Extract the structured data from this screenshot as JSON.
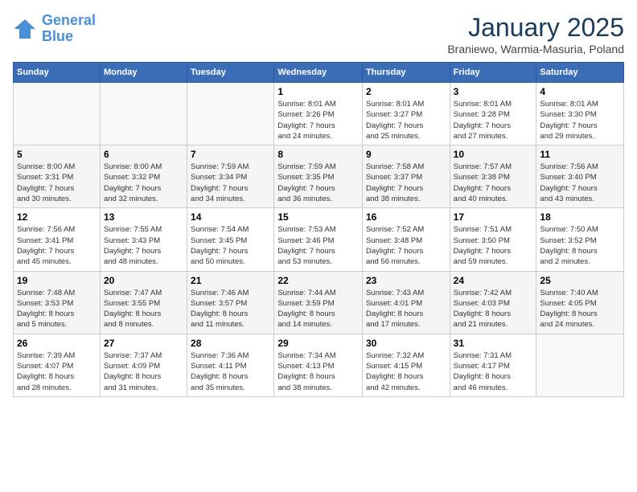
{
  "header": {
    "logo_line1": "General",
    "logo_line2": "Blue",
    "title": "January 2025",
    "subtitle": "Braniewo, Warmia-Masuria, Poland"
  },
  "days_of_week": [
    "Sunday",
    "Monday",
    "Tuesday",
    "Wednesday",
    "Thursday",
    "Friday",
    "Saturday"
  ],
  "weeks": [
    [
      {
        "day": "",
        "info": ""
      },
      {
        "day": "",
        "info": ""
      },
      {
        "day": "",
        "info": ""
      },
      {
        "day": "1",
        "info": "Sunrise: 8:01 AM\nSunset: 3:26 PM\nDaylight: 7 hours\nand 24 minutes."
      },
      {
        "day": "2",
        "info": "Sunrise: 8:01 AM\nSunset: 3:27 PM\nDaylight: 7 hours\nand 25 minutes."
      },
      {
        "day": "3",
        "info": "Sunrise: 8:01 AM\nSunset: 3:28 PM\nDaylight: 7 hours\nand 27 minutes."
      },
      {
        "day": "4",
        "info": "Sunrise: 8:01 AM\nSunset: 3:30 PM\nDaylight: 7 hours\nand 29 minutes."
      }
    ],
    [
      {
        "day": "5",
        "info": "Sunrise: 8:00 AM\nSunset: 3:31 PM\nDaylight: 7 hours\nand 30 minutes."
      },
      {
        "day": "6",
        "info": "Sunrise: 8:00 AM\nSunset: 3:32 PM\nDaylight: 7 hours\nand 32 minutes."
      },
      {
        "day": "7",
        "info": "Sunrise: 7:59 AM\nSunset: 3:34 PM\nDaylight: 7 hours\nand 34 minutes."
      },
      {
        "day": "8",
        "info": "Sunrise: 7:59 AM\nSunset: 3:35 PM\nDaylight: 7 hours\nand 36 minutes."
      },
      {
        "day": "9",
        "info": "Sunrise: 7:58 AM\nSunset: 3:37 PM\nDaylight: 7 hours\nand 38 minutes."
      },
      {
        "day": "10",
        "info": "Sunrise: 7:57 AM\nSunset: 3:38 PM\nDaylight: 7 hours\nand 40 minutes."
      },
      {
        "day": "11",
        "info": "Sunrise: 7:56 AM\nSunset: 3:40 PM\nDaylight: 7 hours\nand 43 minutes."
      }
    ],
    [
      {
        "day": "12",
        "info": "Sunrise: 7:56 AM\nSunset: 3:41 PM\nDaylight: 7 hours\nand 45 minutes."
      },
      {
        "day": "13",
        "info": "Sunrise: 7:55 AM\nSunset: 3:43 PM\nDaylight: 7 hours\nand 48 minutes."
      },
      {
        "day": "14",
        "info": "Sunrise: 7:54 AM\nSunset: 3:45 PM\nDaylight: 7 hours\nand 50 minutes."
      },
      {
        "day": "15",
        "info": "Sunrise: 7:53 AM\nSunset: 3:46 PM\nDaylight: 7 hours\nand 53 minutes."
      },
      {
        "day": "16",
        "info": "Sunrise: 7:52 AM\nSunset: 3:48 PM\nDaylight: 7 hours\nand 56 minutes."
      },
      {
        "day": "17",
        "info": "Sunrise: 7:51 AM\nSunset: 3:50 PM\nDaylight: 7 hours\nand 59 minutes."
      },
      {
        "day": "18",
        "info": "Sunrise: 7:50 AM\nSunset: 3:52 PM\nDaylight: 8 hours\nand 2 minutes."
      }
    ],
    [
      {
        "day": "19",
        "info": "Sunrise: 7:48 AM\nSunset: 3:53 PM\nDaylight: 8 hours\nand 5 minutes."
      },
      {
        "day": "20",
        "info": "Sunrise: 7:47 AM\nSunset: 3:55 PM\nDaylight: 8 hours\nand 8 minutes."
      },
      {
        "day": "21",
        "info": "Sunrise: 7:46 AM\nSunset: 3:57 PM\nDaylight: 8 hours\nand 11 minutes."
      },
      {
        "day": "22",
        "info": "Sunrise: 7:44 AM\nSunset: 3:59 PM\nDaylight: 8 hours\nand 14 minutes."
      },
      {
        "day": "23",
        "info": "Sunrise: 7:43 AM\nSunset: 4:01 PM\nDaylight: 8 hours\nand 17 minutes."
      },
      {
        "day": "24",
        "info": "Sunrise: 7:42 AM\nSunset: 4:03 PM\nDaylight: 8 hours\nand 21 minutes."
      },
      {
        "day": "25",
        "info": "Sunrise: 7:40 AM\nSunset: 4:05 PM\nDaylight: 8 hours\nand 24 minutes."
      }
    ],
    [
      {
        "day": "26",
        "info": "Sunrise: 7:39 AM\nSunset: 4:07 PM\nDaylight: 8 hours\nand 28 minutes."
      },
      {
        "day": "27",
        "info": "Sunrise: 7:37 AM\nSunset: 4:09 PM\nDaylight: 8 hours\nand 31 minutes."
      },
      {
        "day": "28",
        "info": "Sunrise: 7:36 AM\nSunset: 4:11 PM\nDaylight: 8 hours\nand 35 minutes."
      },
      {
        "day": "29",
        "info": "Sunrise: 7:34 AM\nSunset: 4:13 PM\nDaylight: 8 hours\nand 38 minutes."
      },
      {
        "day": "30",
        "info": "Sunrise: 7:32 AM\nSunset: 4:15 PM\nDaylight: 8 hours\nand 42 minutes."
      },
      {
        "day": "31",
        "info": "Sunrise: 7:31 AM\nSunset: 4:17 PM\nDaylight: 8 hours\nand 46 minutes."
      },
      {
        "day": "",
        "info": ""
      }
    ]
  ]
}
